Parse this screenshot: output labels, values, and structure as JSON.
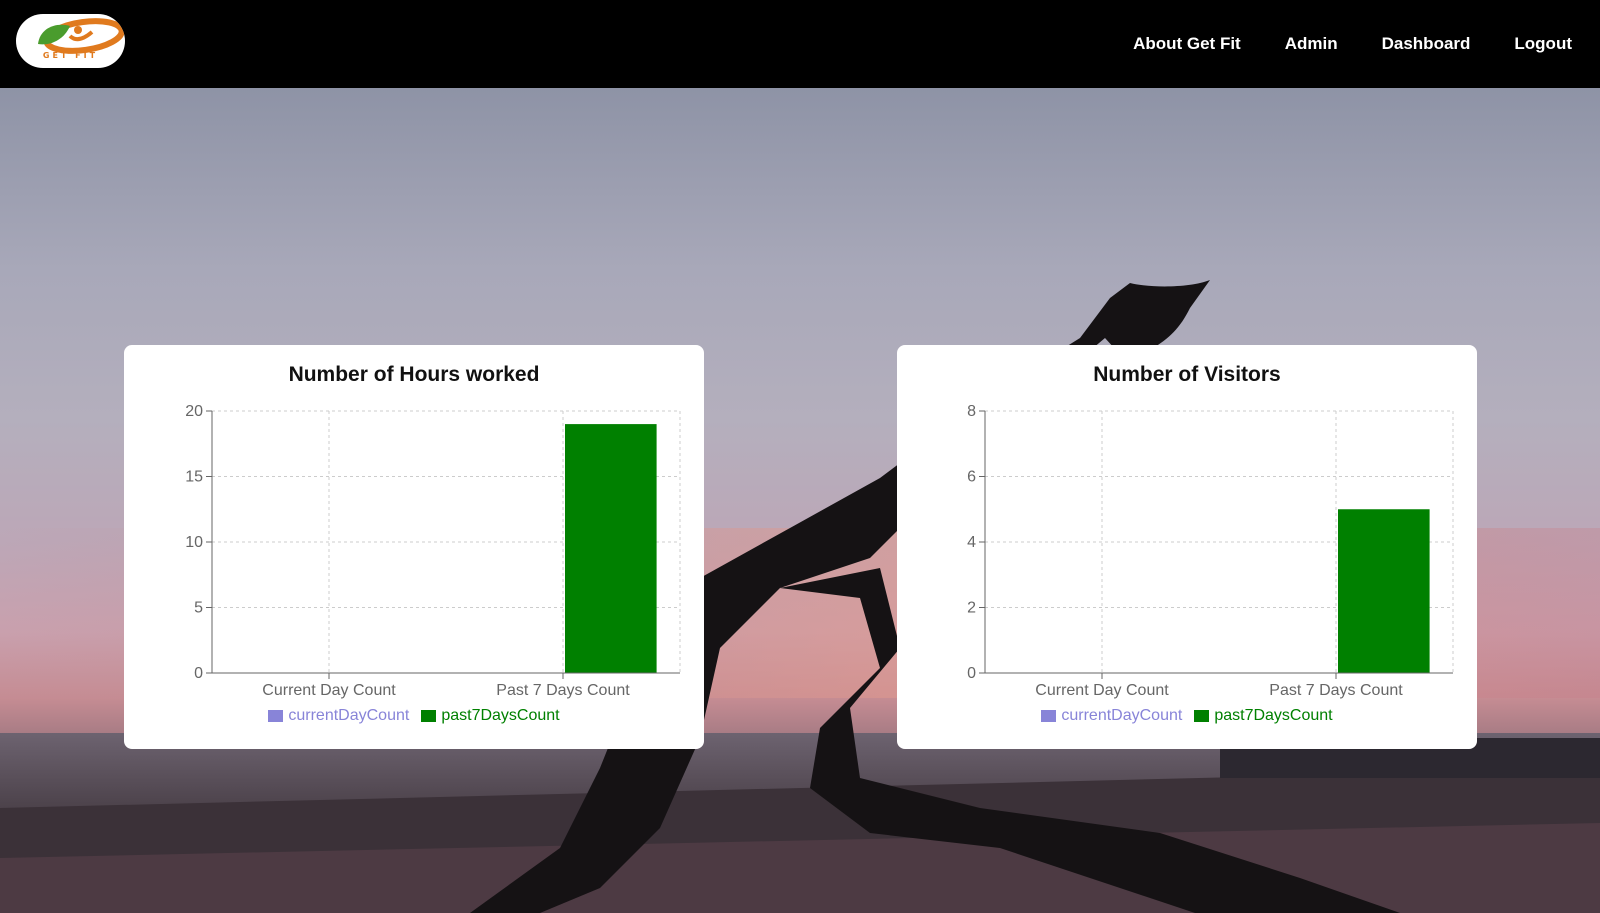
{
  "navbar": {
    "logo_text": "GET FIT",
    "links": [
      {
        "label": "About Get Fit"
      },
      {
        "label": "Admin"
      },
      {
        "label": "Dashboard"
      },
      {
        "label": "Logout"
      }
    ]
  },
  "colors": {
    "navbar_bg": "#000000",
    "card_bg": "#ffffff",
    "current_day_series": "#8884d8",
    "past_7_days_series": "#008000"
  },
  "charts": [
    {
      "id": "hours",
      "title": "Number of Hours worked",
      "legend": [
        {
          "label": "currentDayCount",
          "color": "#8884d8"
        },
        {
          "label": "past7DaysCount",
          "color": "#008000"
        }
      ]
    },
    {
      "id": "visitors",
      "title": "Number of Visitors",
      "legend": [
        {
          "label": "currentDayCount",
          "color": "#8884d8"
        },
        {
          "label": "past7DaysCount",
          "color": "#008000"
        }
      ]
    }
  ],
  "chart_data": [
    {
      "type": "bar",
      "title": "Number of Hours worked",
      "categories": [
        "Current Day Count",
        "Past 7 Days Count"
      ],
      "series": [
        {
          "name": "currentDayCount",
          "values": [
            0,
            0
          ],
          "color": "#8884d8"
        },
        {
          "name": "past7DaysCount",
          "values": [
            0,
            19
          ],
          "color": "#008000"
        }
      ],
      "yticks": [
        0,
        5,
        10,
        15,
        20
      ],
      "ylim": [
        0,
        20
      ],
      "grid": true,
      "legend_position": "bottom"
    },
    {
      "type": "bar",
      "title": "Number of Visitors",
      "categories": [
        "Current Day Count",
        "Past 7 Days Count"
      ],
      "series": [
        {
          "name": "currentDayCount",
          "values": [
            0,
            0
          ],
          "color": "#8884d8"
        },
        {
          "name": "past7DaysCount",
          "values": [
            0,
            5
          ],
          "color": "#008000"
        }
      ],
      "yticks": [
        0,
        2,
        4,
        6,
        8
      ],
      "ylim": [
        0,
        8
      ],
      "grid": true,
      "legend_position": "bottom"
    }
  ]
}
